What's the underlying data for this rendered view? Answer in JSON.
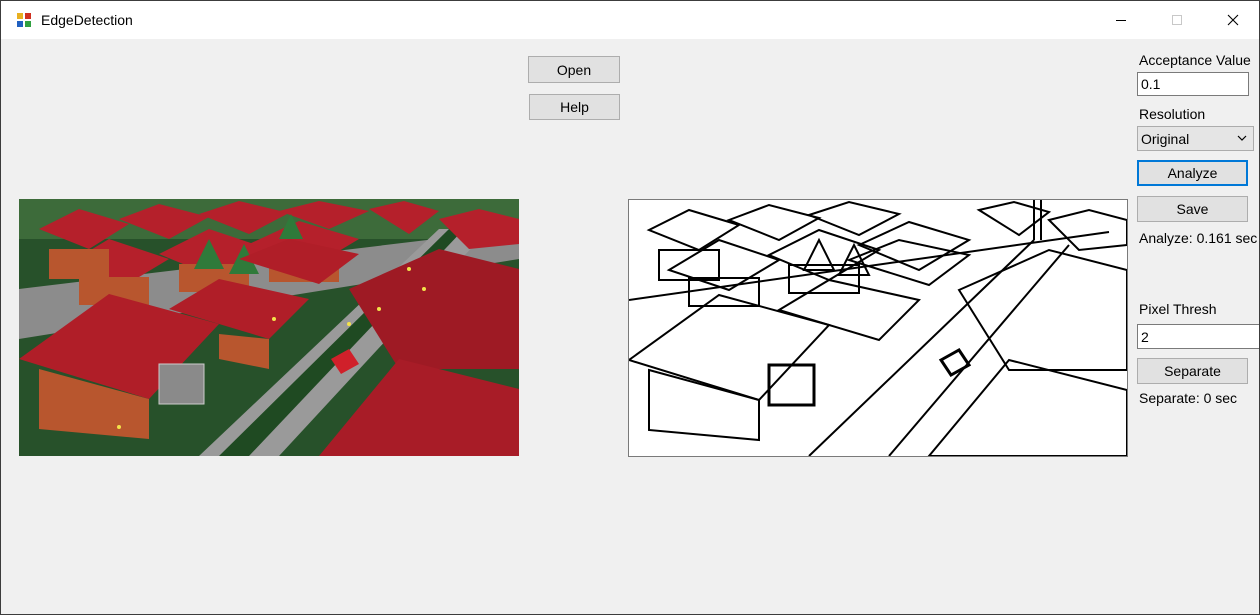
{
  "window": {
    "title": "EdgeDetection"
  },
  "buttons": {
    "open": "Open",
    "help": "Help",
    "analyze": "Analyze",
    "save": "Save",
    "separate": "Separate"
  },
  "settings": {
    "acceptance_label": "Acceptance Value",
    "acceptance_value": "0.1",
    "resolution_label": "Resolution",
    "resolution_value": "Original",
    "analyze_time": "Analyze: 0.161 sec",
    "pixel_thresh_label": "Pixel Thresh",
    "pixel_thresh_value": "2",
    "separate_time": "Separate: 0 sec"
  },
  "images": {
    "source": "source-render-image",
    "edges": "edge-detected-image"
  },
  "colors": {
    "accent": "#0078d7",
    "roof": "#b5202b",
    "grass": "#1f4a22",
    "brick": "#b8562e"
  }
}
